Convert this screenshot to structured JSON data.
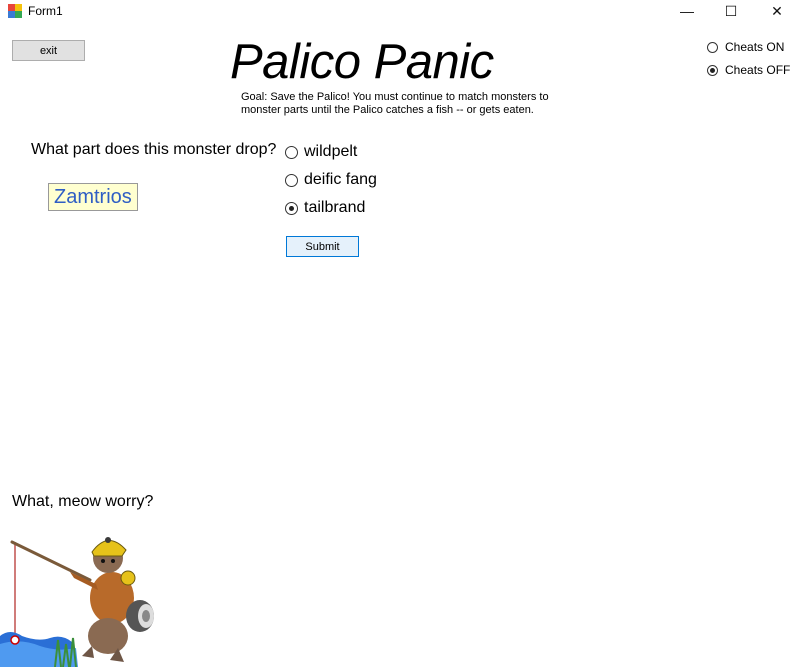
{
  "window": {
    "title": "Form1",
    "minimize_glyph": "—",
    "maximize_glyph": "☐",
    "close_glyph": "✕"
  },
  "toolbar": {
    "exit_label": "exit"
  },
  "header": {
    "title": "Palico Panic",
    "goal_line1": "Goal: Save the Palico! You must continue to match monsters to",
    "goal_line2": "monster parts until the Palico catches a fish -- or gets eaten."
  },
  "cheats": {
    "on_label": "Cheats ON",
    "off_label": "Cheats OFF",
    "selected": "off"
  },
  "quiz": {
    "question": "What part does this monster drop?",
    "monster": "Zamtrios",
    "options": [
      {
        "label": "wildpelt",
        "checked": false
      },
      {
        "label": "deific fang",
        "checked": false
      },
      {
        "label": "tailbrand",
        "checked": true
      }
    ],
    "submit_label": "Submit"
  },
  "footer": {
    "status": "What, meow worry?"
  },
  "colors": {
    "monster_text": "#2f5ec4",
    "monster_bg": "#ffffd0",
    "submit_border": "#0078d7"
  }
}
